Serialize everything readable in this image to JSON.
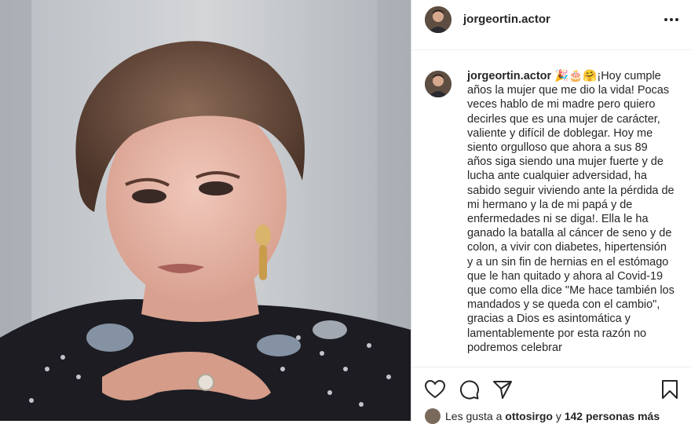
{
  "post": {
    "username": "jorgeortin.actor",
    "caption_emojis": "🎉🎂🤗",
    "caption_text": "¡Hoy cumple años la mujer que me dio la vida! Pocas veces hablo de mi madre pero quiero decirles que es una mujer de carácter, valiente y difícil de doblegar. Hoy me siento orgulloso que ahora a sus 89 años siga siendo una mujer fuerte y de lucha ante cualquier adversidad, ha sabido seguir viviendo ante la pérdida de mi hermano y la de mi papá y de enfermedades ni se diga!. Ella le ha ganado la batalla al cáncer de seno y de colon, a vivir con diabetes, hipertensión y a un sin fin de hernias en el estómago que le han quitado y ahora al Covid-19 que como ella dice \"Me hace también los mandados y se queda con el cambio\", gracias a Dios es asintomática y lamentablemente por esta razón no podremos celebrar"
  },
  "likes": {
    "prefix": "Les gusta a",
    "user": "ottosirgo",
    "conj": "y",
    "others": "142 personas más"
  },
  "icons": {
    "more": "more-options-icon",
    "like": "heart-icon",
    "comment": "comment-icon",
    "share": "share-icon",
    "save": "bookmark-icon"
  },
  "colors": {
    "text": "#262626",
    "border": "#dbdbdb"
  }
}
